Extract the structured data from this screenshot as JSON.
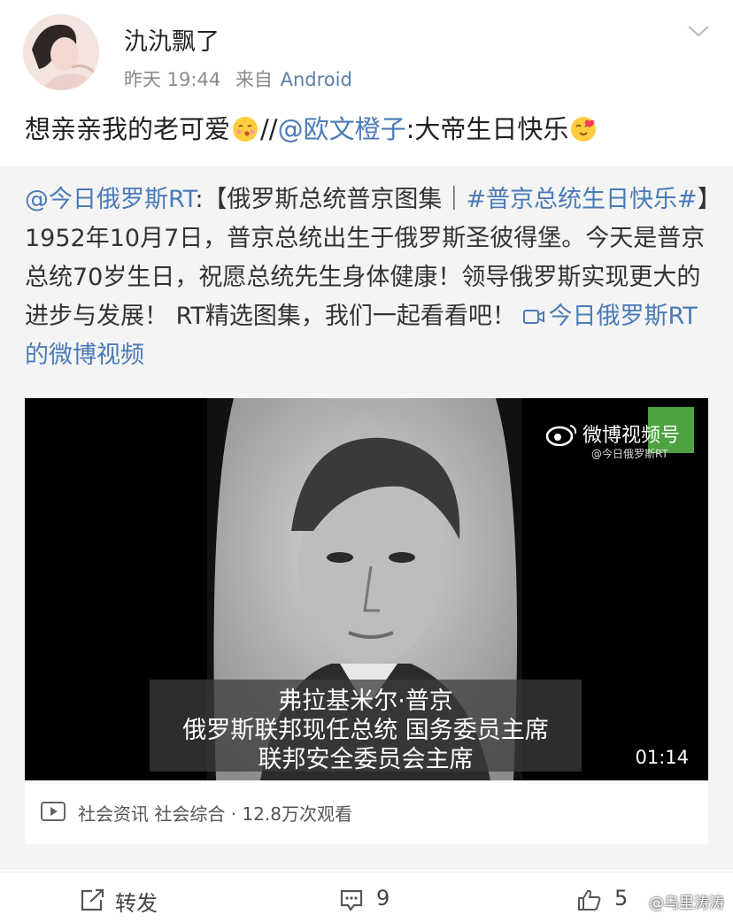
{
  "post": {
    "username": "氿氿飘了",
    "time": "昨天 19:44",
    "source_prefix": "来自",
    "source": "Android",
    "text_before": "想亲亲我的老可爱",
    "separator": "//",
    "mention": "@欧文橙子",
    "text_after": ":大帝生日快乐"
  },
  "quoted": {
    "author": "@今日俄罗斯RT",
    "colon": ":",
    "bracket_open": "【俄罗斯总统普京图集｜",
    "hashtag": "#普京总统生日快乐#",
    "body": "】1952年10月7日，普京总统出生于俄罗斯圣彼得堡。今天是普京总统70岁生日，祝愿总统先生身体健康！领导俄罗斯实现更大的进步与发展！ RT精选图集，我们一起看看吧！",
    "video_link": "今日俄罗斯RT的微博视频"
  },
  "video": {
    "watermark": "微博视频号",
    "watermark_sub": "@今日俄罗斯RT",
    "subtitle_lines": [
      "弗拉基米尔·普京",
      "俄罗斯联邦现任总统 国务委员主席",
      "联邦安全委员会主席"
    ],
    "duration": "01:14",
    "meta": "社会资讯 社会综合 · 12.8万次观看"
  },
  "actions": {
    "repost": "转发",
    "comments": "9",
    "likes": "5"
  },
  "image_watermark": "@乌里涛涛",
  "icons": {
    "chevron": "chevron-down-icon",
    "repost": "share-icon",
    "comment": "comment-icon",
    "like": "thumbs-up-icon",
    "play": "play-icon"
  },
  "colors": {
    "link": "#4a7bb7",
    "meta": "#8b8b8b",
    "quote_bg": "#f4f4f4"
  }
}
